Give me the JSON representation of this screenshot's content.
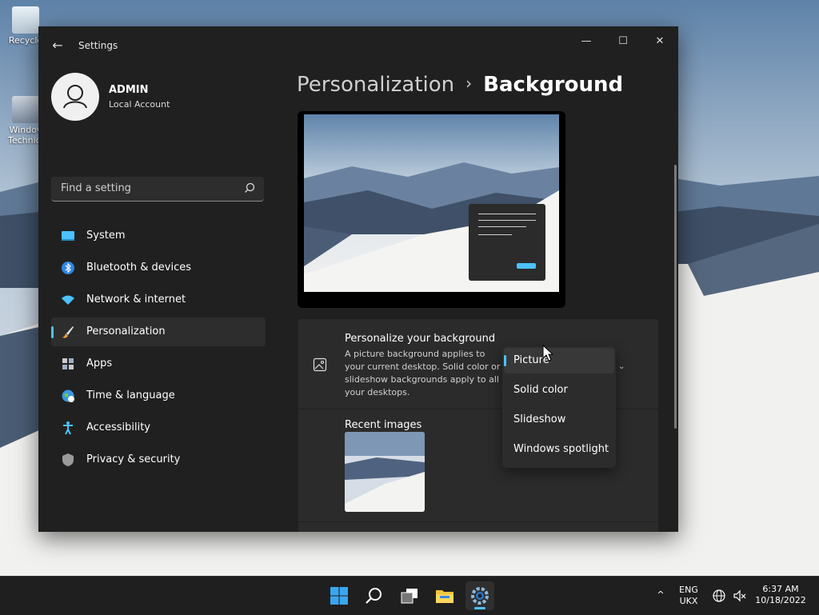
{
  "desktop": {
    "icons": [
      {
        "label": "Recycle",
        "icon": "recycle-bin-icon"
      },
      {
        "label": "Windov Technica",
        "icon": "app-shortcut-icon"
      }
    ]
  },
  "window": {
    "app_title": "Settings",
    "controls": {
      "minimize": "—",
      "maximize": "☐",
      "close": "✕"
    },
    "back_icon": "←"
  },
  "user": {
    "name": "ADMIN",
    "type": "Local Account",
    "avatar_icon": "user-avatar-icon"
  },
  "search": {
    "placeholder": "Find a setting",
    "value": ""
  },
  "nav": {
    "items": [
      {
        "label": "System",
        "icon": "system-display-icon",
        "active": false
      },
      {
        "label": "Bluetooth & devices",
        "icon": "bluetooth-icon",
        "active": false
      },
      {
        "label": "Network & internet",
        "icon": "wifi-icon",
        "active": false
      },
      {
        "label": "Personalization",
        "icon": "paintbrush-icon",
        "active": true
      },
      {
        "label": "Apps",
        "icon": "apps-icon",
        "active": false
      },
      {
        "label": "Time & language",
        "icon": "globe-clock-icon",
        "active": false
      },
      {
        "label": "Accessibility",
        "icon": "accessibility-icon",
        "active": false
      },
      {
        "label": "Privacy & security",
        "icon": "shield-icon",
        "active": false
      }
    ]
  },
  "breadcrumb": {
    "parent": "Personalization",
    "separator": "›",
    "current": "Background"
  },
  "background_card": {
    "title": "Personalize your background",
    "description": "A picture background applies to your current desktop. Solid color or slideshow backgrounds apply to all your desktops.",
    "icon": "image-icon"
  },
  "dropdown": {
    "selected": "Picture",
    "options": [
      "Picture",
      "Solid color",
      "Slideshow",
      "Windows spotlight"
    ]
  },
  "recent": {
    "title": "Recent images"
  },
  "taskbar": {
    "apps": [
      "start-icon",
      "search-icon",
      "task-view-icon",
      "file-explorer-icon",
      "settings-icon"
    ],
    "active_app": "settings-icon",
    "language": {
      "line1": "ENG",
      "line2": "UKX"
    },
    "time": "6:37 AM",
    "date": "10/18/2022"
  },
  "colors": {
    "accent": "#4cc2ff",
    "window_bg": "#202020",
    "card_bg": "#2b2b2b"
  }
}
